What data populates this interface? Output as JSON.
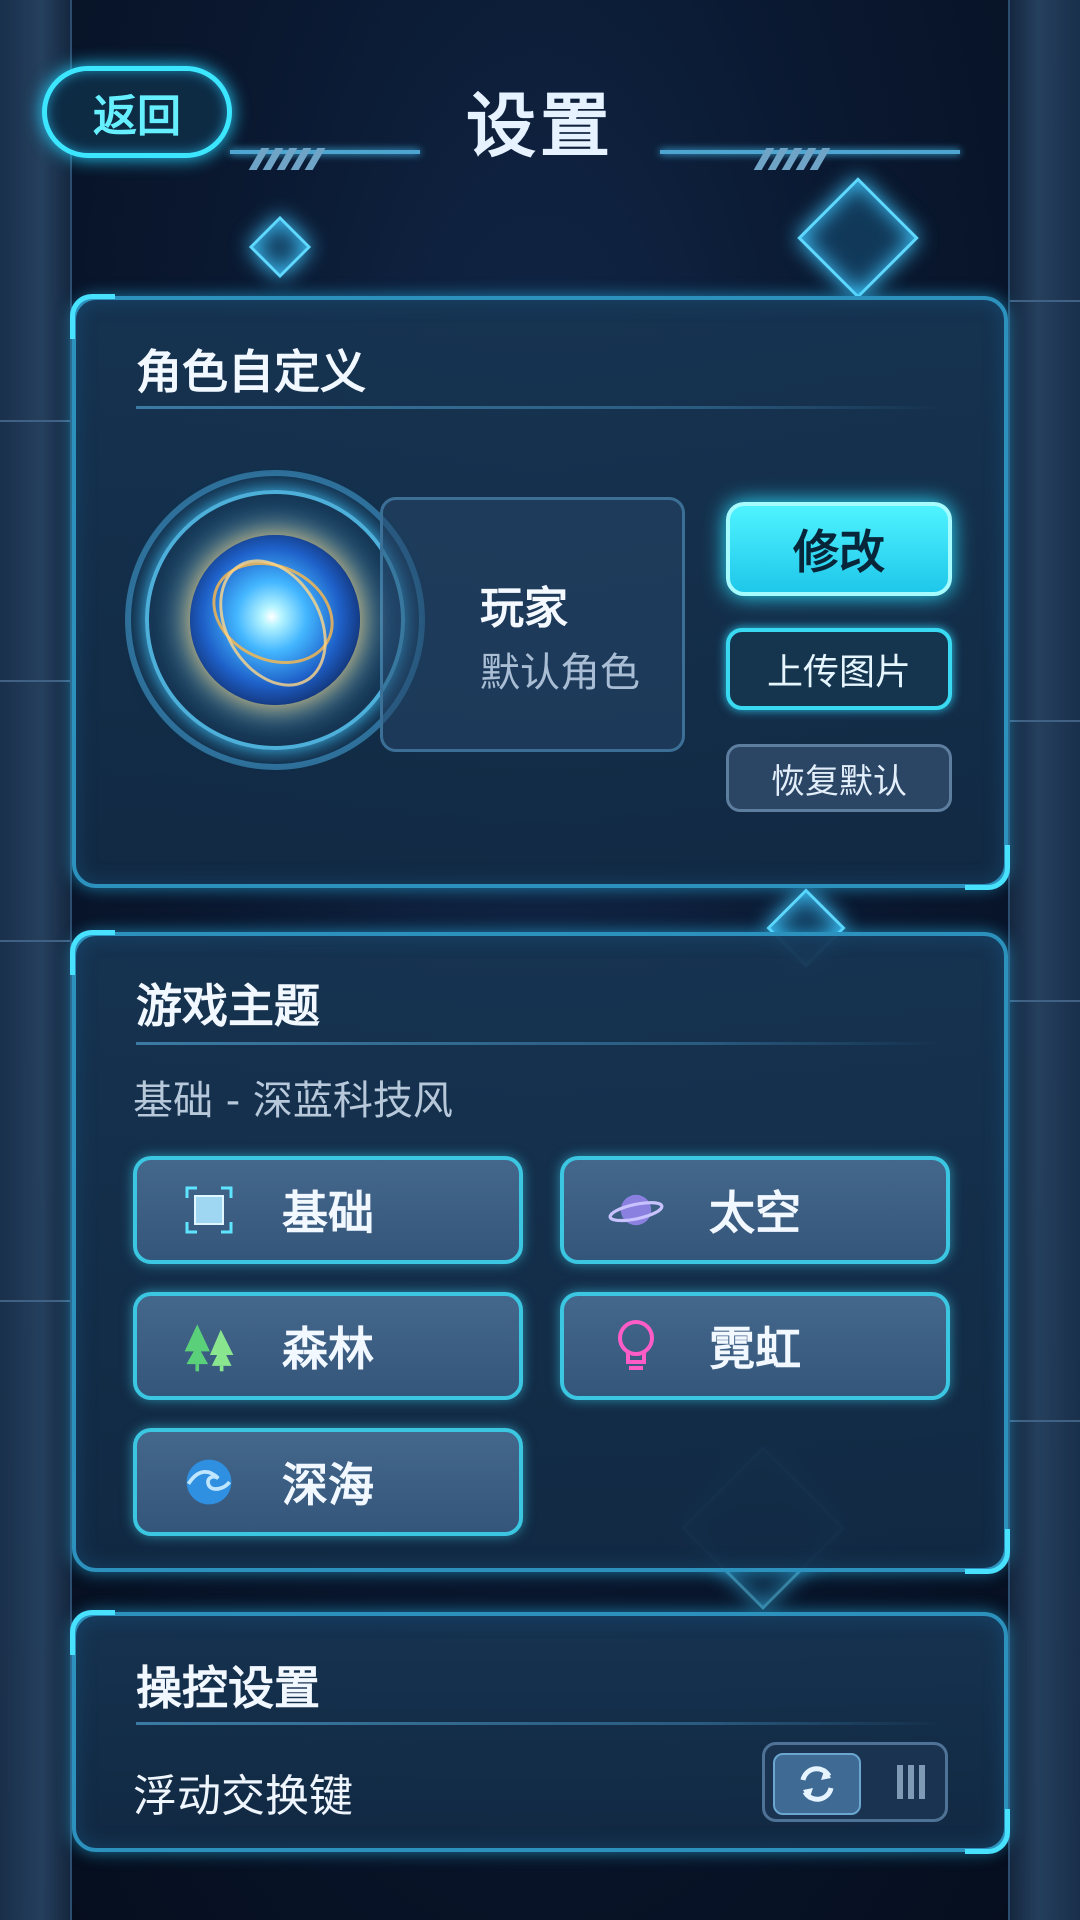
{
  "header": {
    "back_label": "返回",
    "title": "设置"
  },
  "character": {
    "section_title": "角色自定义",
    "player_name": "玩家",
    "player_role": "默认角色",
    "edit_label": "修改",
    "upload_label": "上传图片",
    "reset_label": "恢复默认"
  },
  "theme": {
    "section_title": "游戏主题",
    "current": "基础 - 深蓝科技风",
    "options": [
      {
        "label": "基础",
        "icon": "square-frame-icon"
      },
      {
        "label": "太空",
        "icon": "planet-icon"
      },
      {
        "label": "森林",
        "icon": "trees-icon"
      },
      {
        "label": "霓虹",
        "icon": "lightbulb-icon"
      },
      {
        "label": "深海",
        "icon": "wave-icon"
      }
    ]
  },
  "controls": {
    "section_title": "操控设置",
    "swap_label": "浮动交换键",
    "swap_enabled": false
  },
  "colors": {
    "accent": "#3de6ff",
    "panel": "#163452",
    "background": "#0a1830"
  }
}
